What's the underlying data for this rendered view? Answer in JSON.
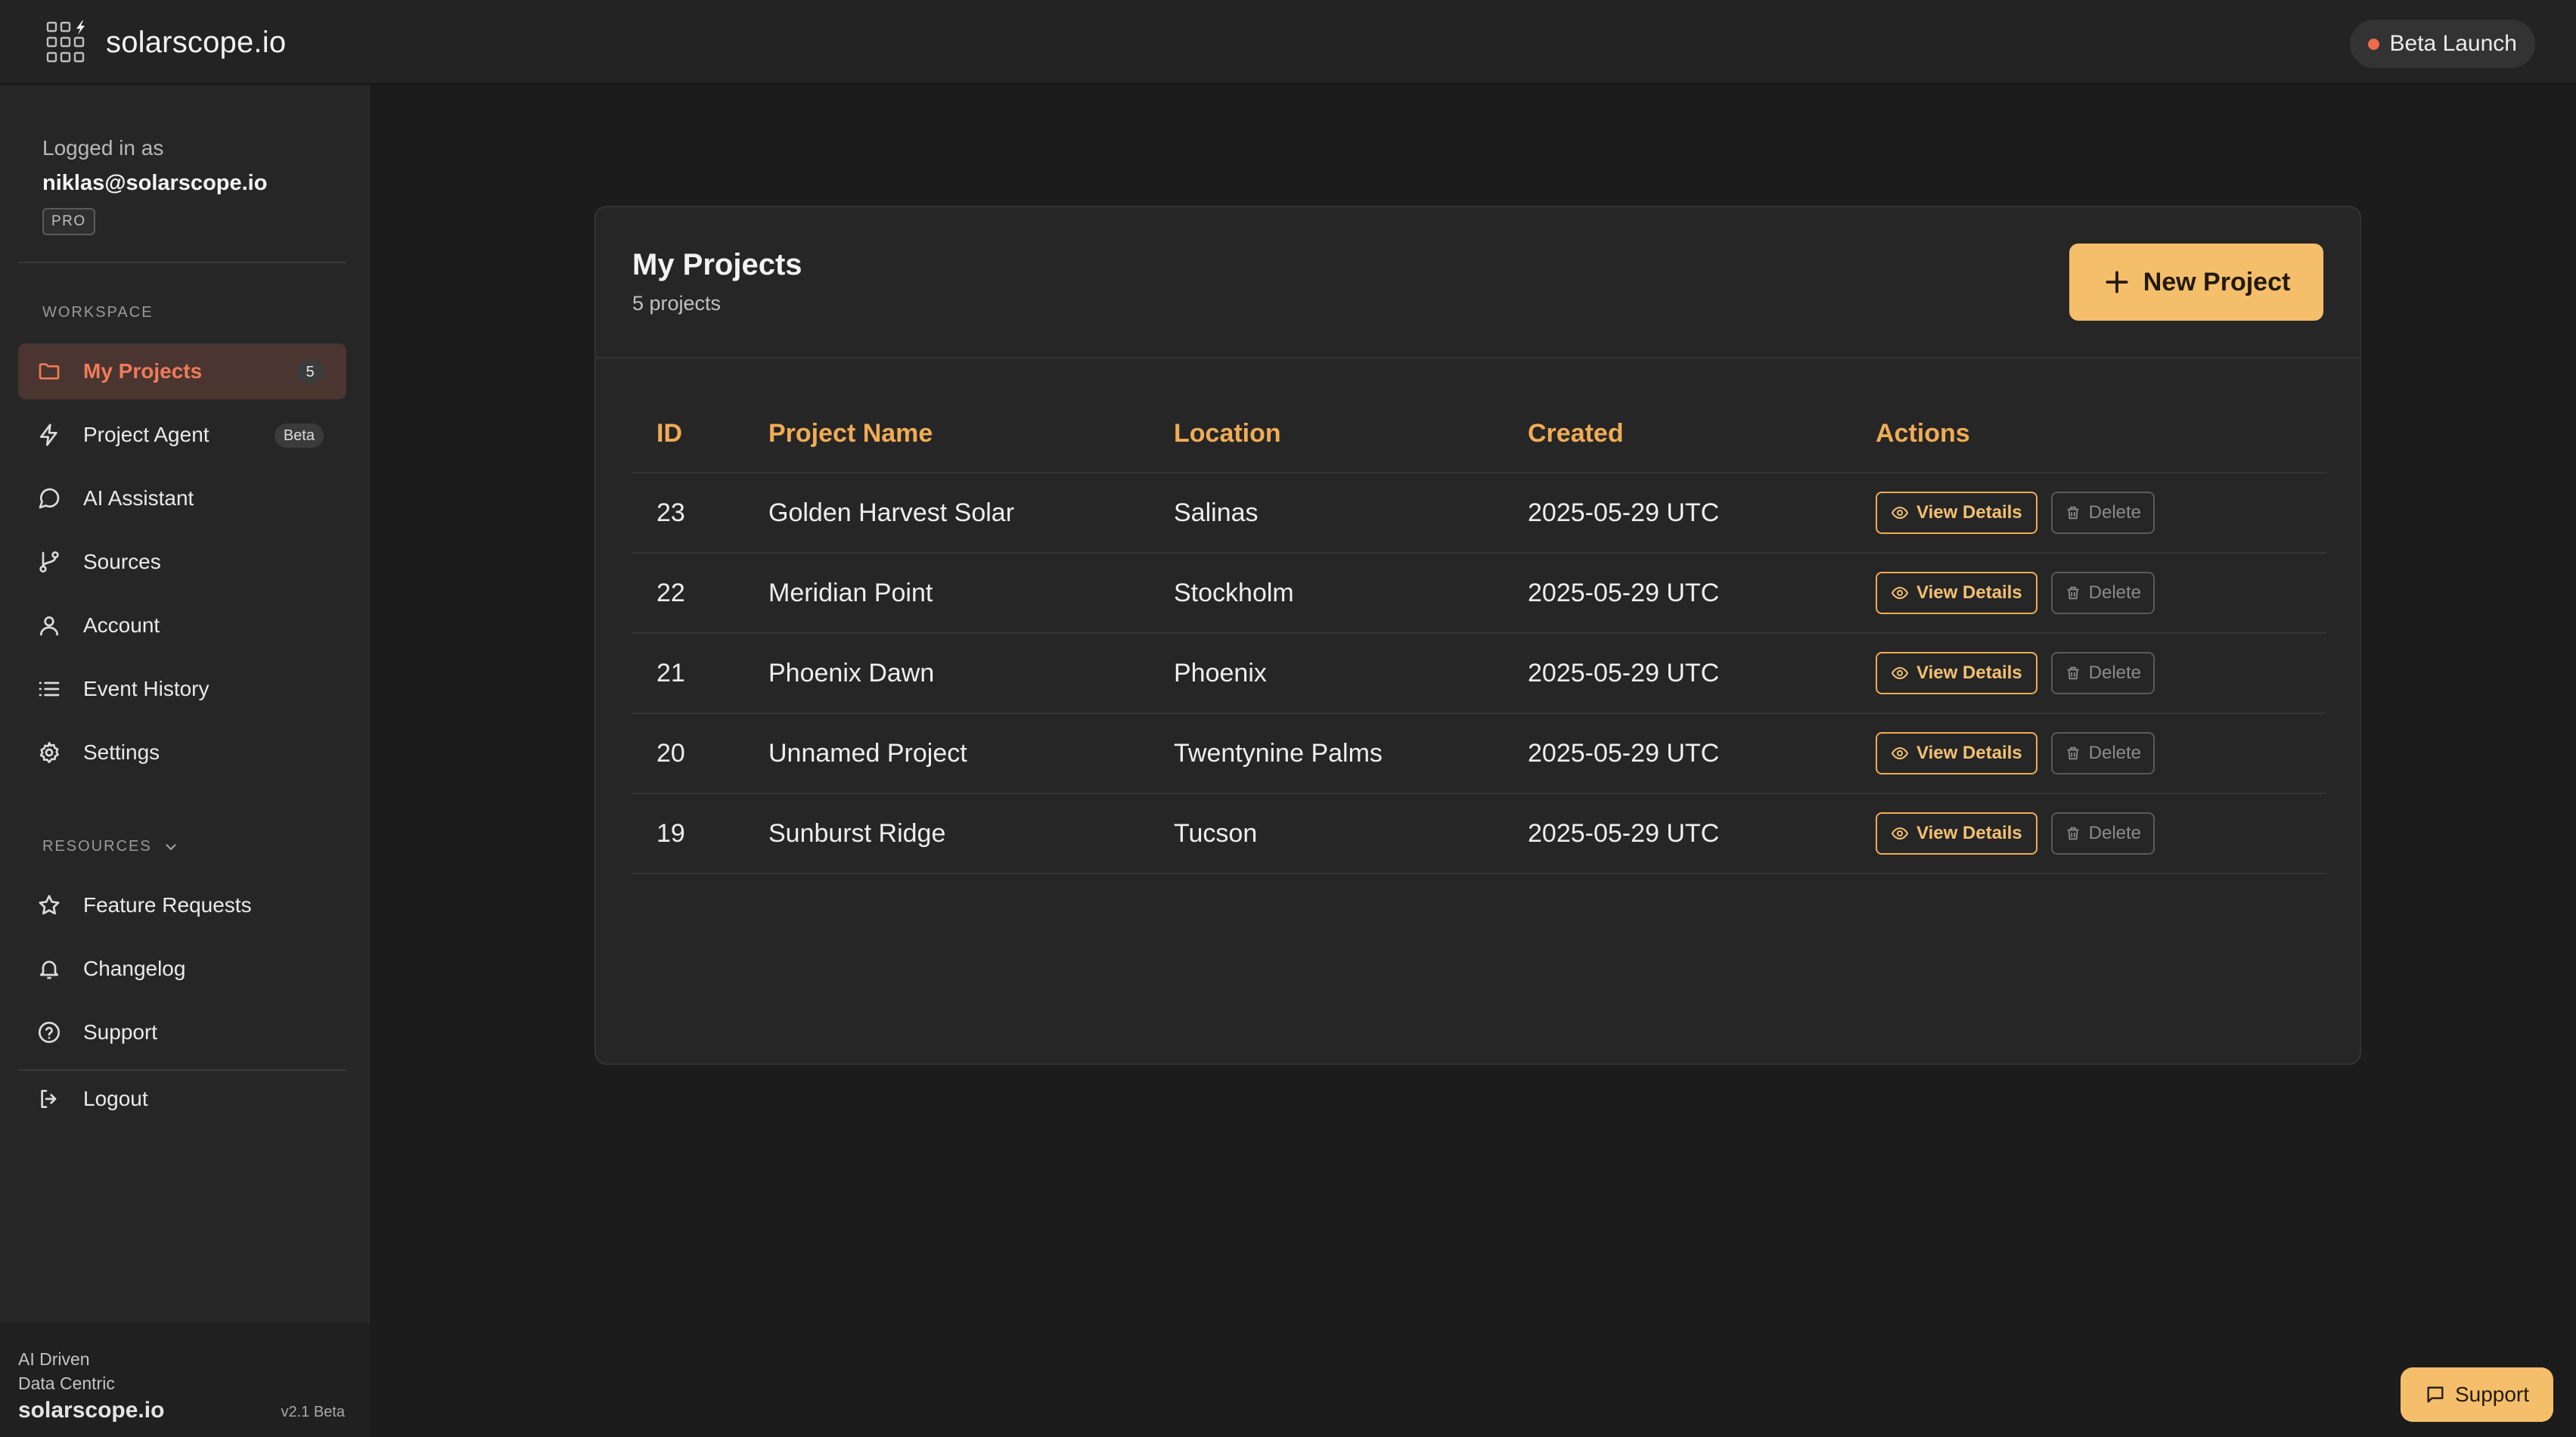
{
  "brand": {
    "name": "solarscope.io"
  },
  "header": {
    "status_pill": "Beta Launch",
    "status_color": "#ef6a4d"
  },
  "sidebar": {
    "logged_in_label": "Logged in as",
    "user_email": "niklas@solarscope.io",
    "plan": "PRO",
    "workspace_heading": "WORKSPACE",
    "resources_heading": "RESOURCES",
    "workspace_items": [
      {
        "label": "My Projects",
        "icon": "folder-icon",
        "count": "5",
        "active": true
      },
      {
        "label": "Project Agent",
        "icon": "lightning-icon",
        "tag": "Beta"
      },
      {
        "label": "AI Assistant",
        "icon": "chat-bubble-icon"
      },
      {
        "label": "Sources",
        "icon": "git-branch-icon"
      },
      {
        "label": "Account",
        "icon": "user-icon"
      },
      {
        "label": "Event History",
        "icon": "list-icon"
      },
      {
        "label": "Settings",
        "icon": "gear-icon"
      }
    ],
    "resource_items": [
      {
        "label": "Feature Requests",
        "icon": "star-icon"
      },
      {
        "label": "Changelog",
        "icon": "bell-icon"
      },
      {
        "label": "Support",
        "icon": "help-circle-icon"
      }
    ],
    "logout_label": "Logout",
    "footer": {
      "line1": "AI Driven",
      "line2": "Data Centric",
      "brand": "solarscope.io",
      "version": "v2.1 Beta"
    }
  },
  "main": {
    "title": "My Projects",
    "subtitle": "5 projects",
    "new_button_label": "New Project",
    "columns": [
      "ID",
      "Project Name",
      "Location",
      "Created",
      "Actions"
    ],
    "view_label": "View Details",
    "delete_label": "Delete",
    "rows": [
      {
        "id": "23",
        "name": "Golden Harvest Solar",
        "location": "Salinas",
        "created": "2025-05-29 UTC"
      },
      {
        "id": "22",
        "name": "Meridian Point",
        "location": "Stockholm",
        "created": "2025-05-29 UTC"
      },
      {
        "id": "21",
        "name": "Phoenix Dawn",
        "location": "Phoenix",
        "created": "2025-05-29 UTC"
      },
      {
        "id": "20",
        "name": "Unnamed Project",
        "location": "Twentynine Palms",
        "created": "2025-05-29 UTC"
      },
      {
        "id": "19",
        "name": "Sunburst Ridge",
        "location": "Tucson",
        "created": "2025-05-29 UTC"
      }
    ]
  },
  "support_button": {
    "label": "Support"
  },
  "colors": {
    "accent": "#f4be6a",
    "accent_text": "#f0ac55",
    "active_nav": "#ef7b5a",
    "background": "#1c1c1c"
  }
}
